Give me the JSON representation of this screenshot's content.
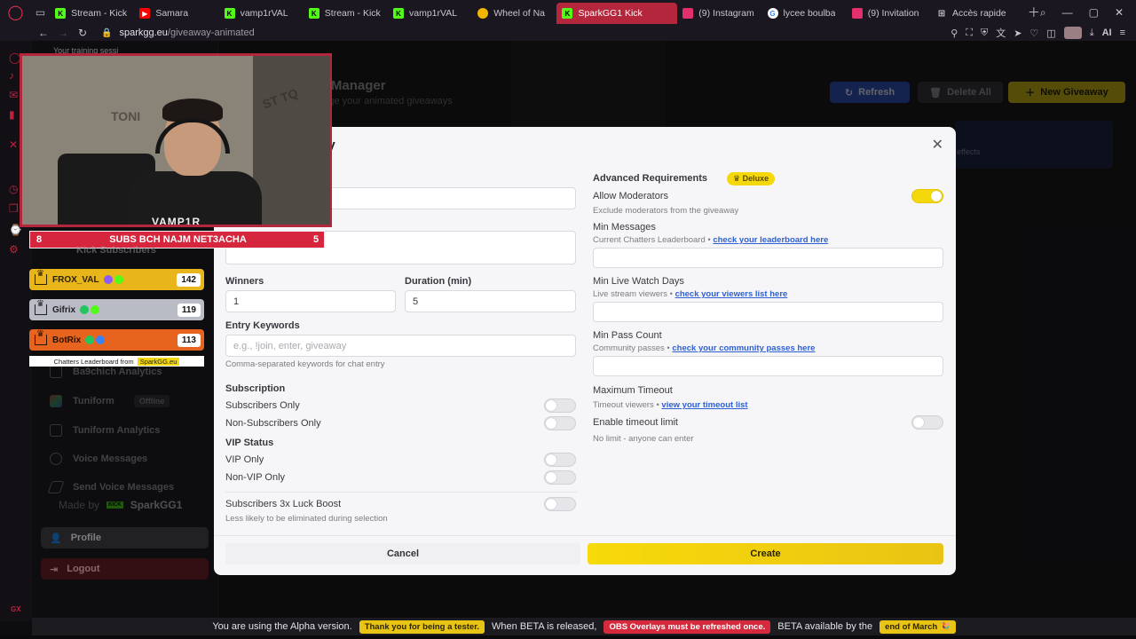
{
  "browser": {
    "tabs": [
      {
        "label": "Stream - Kick",
        "fav_color": "#53fc18"
      },
      {
        "label": "Samara",
        "fav_color": "#ff0000"
      },
      {
        "label": "vamp1rVAL",
        "fav_color": "#53fc18"
      },
      {
        "label": "Stream - Kick",
        "fav_color": "#53fc18"
      },
      {
        "label": "vamp1rVAL",
        "fav_color": "#53fc18"
      },
      {
        "label": "Wheel of Na",
        "fav_color": "#f4b400"
      },
      {
        "label": "SparkGG1 Kick",
        "fav_color": "#53fc18",
        "active": true
      },
      {
        "label": "(9) Instagram",
        "fav_color": "#e1306c"
      },
      {
        "label": "lycee boulba",
        "fav_color": "#4285f4"
      },
      {
        "label": "(9) Invitation",
        "fav_color": "#e1306c"
      },
      {
        "label": "Accès rapide",
        "fav_color": "#888888"
      }
    ],
    "url_domain": "sparkgg.eu",
    "url_path": "/giveaway-animated",
    "ai_label": "AI"
  },
  "sidebar": {
    "items": [
      {
        "label": "Ba9chich Analytics"
      },
      {
        "label": "Tuniform",
        "badge": "Offline"
      },
      {
        "label": "Tuniform Analytics"
      },
      {
        "label": "Voice Messages"
      },
      {
        "label": "Send Voice Messages"
      }
    ],
    "made_by_prefix": "Made by",
    "made_by_name": "SparkGG1",
    "kick_tag": "KICK",
    "profile_label": "Profile",
    "logout_label": "Logout"
  },
  "page": {
    "title": "ay Manager",
    "subtitle": "anage your animated giveaways",
    "refresh_label": "Refresh",
    "delete_all_label": "Delete All",
    "new_giveaway_label": "New Giveaway",
    "info_panel_text": "effects"
  },
  "modal": {
    "title": "ay",
    "winners_label": "Winners",
    "winners_value": "1",
    "duration_label": "Duration (min)",
    "duration_value": "5",
    "entry_keywords_label": "Entry Keywords",
    "entry_keywords_placeholder": "e.g., !join, enter, giveaway",
    "entry_keywords_hint": "Comma-separated keywords for chat entry",
    "description_placeholder": "eaway...",
    "subscription_label": "Subscription",
    "subscribers_only": "Subscribers Only",
    "non_subscribers_only": "Non-Subscribers Only",
    "vip_status_label": "VIP Status",
    "vip_only": "VIP Only",
    "non_vip_only": "Non-VIP Only",
    "luck_boost_label": "Subscribers 3x Luck Boost",
    "luck_boost_hint": "Less likely to be eliminated during selection",
    "advanced_label": "Advanced Requirements",
    "deluxe_badge": "Deluxe",
    "allow_mods_label": "Allow Moderators",
    "allow_mods_hint": "Exclude moderators from the giveaway",
    "min_messages_label": "Min Messages",
    "min_messages_hint": "Current Chatters Leaderboard •",
    "min_messages_link": "check your leaderboard here",
    "min_watch_label": "Min Live Watch Days",
    "min_watch_hint": "Live stream viewers •",
    "min_watch_link": "check your viewers list here",
    "min_pass_label": "Min Pass Count",
    "min_pass_hint": "Community passes •",
    "min_pass_link": "check your community passes here",
    "max_timeout_label": "Maximum Timeout",
    "max_timeout_hint": "Timeout viewers •",
    "max_timeout_link": "view your timeout list",
    "enable_timeout_label": "Enable timeout limit",
    "enable_timeout_hint": "No limit - anyone can enter",
    "cancel_label": "Cancel",
    "create_label": "Create",
    "toggles": {
      "subscribers_only": false,
      "non_subscribers_only": false,
      "vip_only": false,
      "non_vip_only": false,
      "luck_boost": false,
      "allow_moderators": true,
      "enable_timeout": false
    }
  },
  "overlay": {
    "training": "Your training sessi",
    "cam_name": "VAMP1R",
    "subs_left": "8",
    "subs_text": "SUBS BCH NAJM NET3ACHA",
    "subs_right": "5",
    "kick_subscribers": "Kick Subscribers",
    "leaderboard": [
      {
        "name": "FROX_VAL",
        "score": "142"
      },
      {
        "name": "Gifrix",
        "score": "119"
      },
      {
        "name": "BotRix",
        "score": "113"
      }
    ],
    "leaderboard_footer": "Chatters Leaderboard from",
    "leaderboard_footer_brand": "SparkGG.eu"
  },
  "alpha_bar": {
    "text1": "You are using the Alpha version.",
    "pill1": "Thank you for being a tester.",
    "text2": "When BETA is released,",
    "pill2": "OBS Overlays must be refreshed once.",
    "text3": "BETA available by the",
    "pill3": "end of March 🎉"
  },
  "gx_label": "GX"
}
